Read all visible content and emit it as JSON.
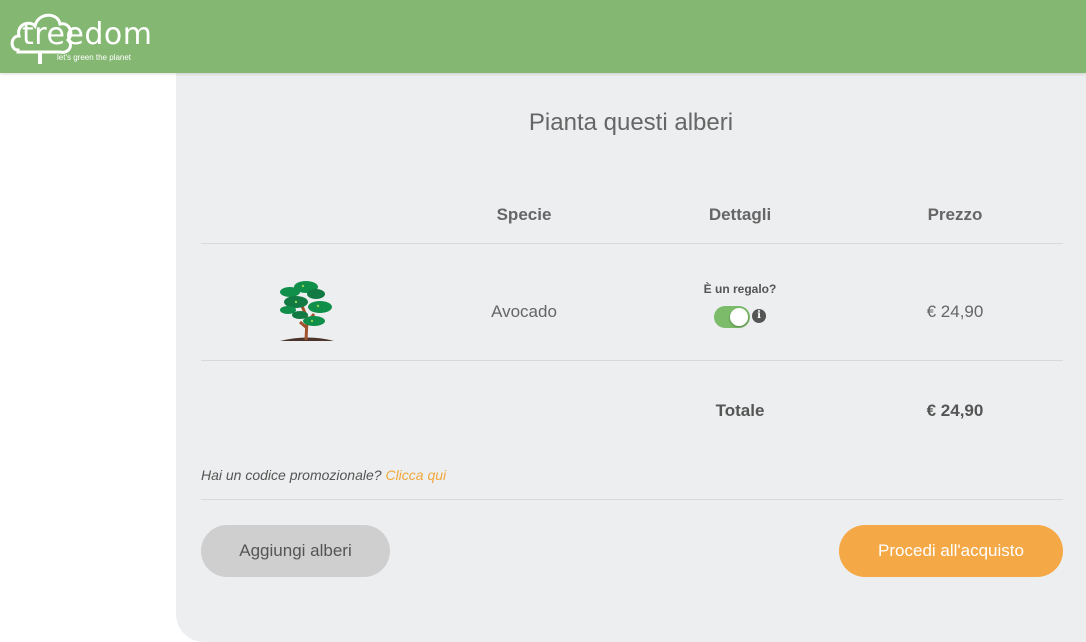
{
  "header": {
    "logo_text": "treedom",
    "tagline": "let's green the planet"
  },
  "cart": {
    "title": "Pianta questi alberi",
    "columns": {
      "species": "Specie",
      "details": "Dettagli",
      "price": "Prezzo"
    },
    "items": [
      {
        "species": "Avocado",
        "gift_label": "È un regalo?",
        "gift_toggle": true,
        "info_glyph": "i",
        "price": "€ 24,90"
      }
    ],
    "total_label": "Totale",
    "total_value": "€ 24,90",
    "promo_text": "Hai un codice promozionale?",
    "promo_link": "Clicca qui",
    "add_button": "Aggiungi alberi",
    "checkout_button": "Procedi all'acquisto"
  },
  "colors": {
    "header_bg": "#84b872",
    "cart_bg": "#edeeef",
    "accent_orange": "#f4a846",
    "toggle_on": "#7cbb6a",
    "tree_leaf": "#0f8f4a"
  },
  "icons": {
    "logo": "tree-cloud-logo",
    "item_image": "tree-icon",
    "info": "info-icon"
  }
}
